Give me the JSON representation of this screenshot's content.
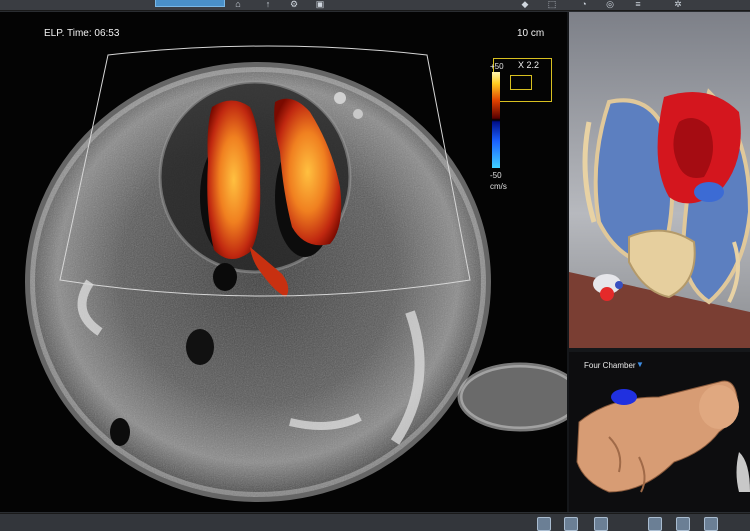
{
  "toolbar": {
    "icons": [
      "tool-icon",
      "pointer-icon",
      "gear-icon",
      "window-icon",
      "pin-icon",
      "select-icon",
      "measure-icon",
      "brush-icon",
      "layers-icon",
      "settings-icon"
    ]
  },
  "ultrasound": {
    "elapsed_time": "ELP. Time: 06:53",
    "depth": "10 cm",
    "zoom": "X 2.2",
    "scale_max": "+50",
    "scale_min": "-50",
    "scale_unit": "cm/s",
    "colors": {
      "positive": "#ffcc20",
      "negative": "#1a60ff"
    }
  },
  "four_chamber": {
    "view_label": "Four Chamber",
    "dropdown_icon": "triangle-down-icon"
  },
  "bottombar": {
    "icons": [
      "single-view-icon",
      "dual-view-icon",
      "quad-view-icon",
      "probe-icon",
      "camera-icon",
      "globe-icon"
    ]
  }
}
